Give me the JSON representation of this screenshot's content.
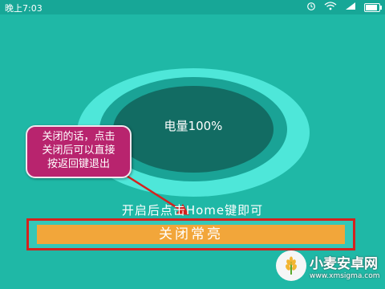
{
  "status_bar": {
    "time": "晚上7:03",
    "icons": [
      "alarm-icon",
      "wifi-icon",
      "signal-icon",
      "battery-icon"
    ]
  },
  "battery": {
    "label": "电量100%",
    "level_percent": 100
  },
  "callout": {
    "lines": [
      "关闭的话，点击",
      "关闭后可以直接",
      "按返回键退出"
    ]
  },
  "hint": "开启后点击Home键即可",
  "close_button_label": "关闭常亮",
  "watermark": {
    "title": "小麦安卓网",
    "url": "www.xmsigma.com"
  },
  "colors": {
    "background": "#1fb8a6",
    "ring_outer": "#4ee7d9",
    "ring_inner": "#126c63",
    "button": "#f2a63a",
    "highlight": "#d4221e",
    "callout": "#b8246e"
  }
}
